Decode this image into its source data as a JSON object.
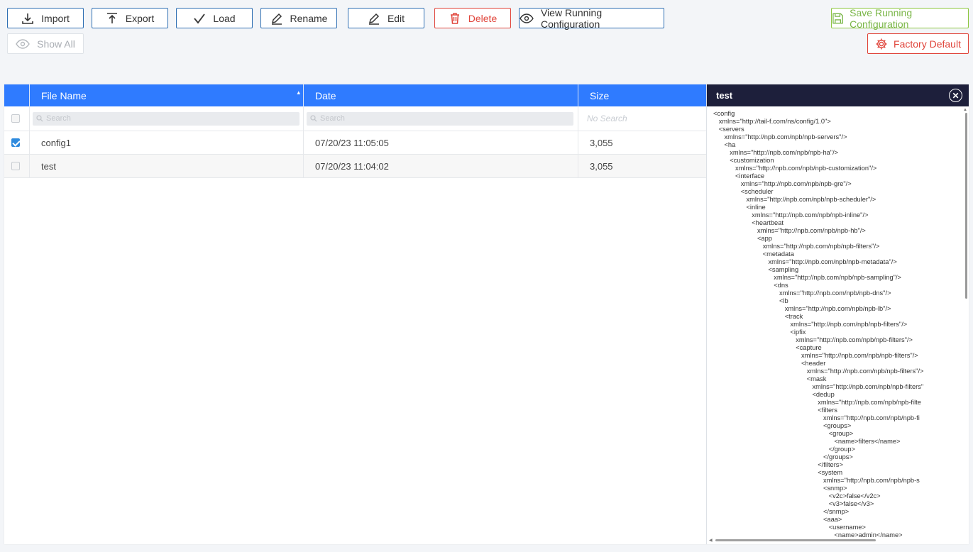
{
  "toolbar": {
    "import_label": "Import",
    "export_label": "Export",
    "load_label": "Load",
    "rename_label": "Rename",
    "edit_label": "Edit",
    "delete_label": "Delete",
    "view_running_label": "View Running Configuration",
    "show_all_label": "Show All",
    "save_running_label": "Save Running Configuration",
    "factory_default_label": "Factory Default"
  },
  "colors": {
    "accent": "#2f7bff",
    "button_border": "#2f6fb3",
    "danger": "#e0443a",
    "success": "#7ab648",
    "panel_header": "#1d1f3b"
  },
  "table": {
    "columns": [
      "File Name",
      "Date",
      "Size"
    ],
    "search_placeholder": "Search",
    "no_search_label": "No Search",
    "rows": [
      {
        "name": "config1",
        "date": "07/20/23 11:05:05",
        "size": "3,055",
        "checked": true
      },
      {
        "name": "test",
        "date": "07/20/23 11:04:02",
        "size": "3,055",
        "checked": false
      }
    ]
  },
  "preview": {
    "title": "test",
    "xml_lines": [
      "<config",
      "   xmlns=\"http://tail-f.com/ns/config/1.0\">",
      "   <servers",
      "      xmlns=\"http://npb.com/npb/npb-servers\"/>",
      "      <ha",
      "         xmlns=\"http://npb.com/npb/npb-ha\"/>",
      "         <customization",
      "            xmlns=\"http://npb.com/npb/npb-customization\"/>",
      "            <interface",
      "               xmlns=\"http://npb.com/npb/npb-gre\"/>",
      "               <scheduler",
      "                  xmlns=\"http://npb.com/npb/npb-scheduler\"/>",
      "                  <inline",
      "                     xmlns=\"http://npb.com/npb/npb-inline\"/>",
      "                     <heartbeat",
      "                        xmlns=\"http://npb.com/npb/npb-hb\"/>",
      "                        <app",
      "                           xmlns=\"http://npb.com/npb/npb-filters\"/>",
      "                           <metadata",
      "                              xmlns=\"http://npb.com/npb/npb-metadata\"/>",
      "                              <sampling",
      "                                 xmlns=\"http://npb.com/npb/npb-sampling\"/>",
      "                                 <dns",
      "                                    xmlns=\"http://npb.com/npb/npb-dns\"/>",
      "                                    <lb",
      "                                       xmlns=\"http://npb.com/npb/npb-lb\"/>",
      "                                       <track",
      "                                          xmlns=\"http://npb.com/npb/npb-filters\"/>",
      "                                          <ipfix",
      "                                             xmlns=\"http://npb.com/npb/npb-filters\"/>",
      "                                             <capture",
      "                                                xmlns=\"http://npb.com/npb/npb-filters\"/>",
      "                                                <header",
      "                                                   xmlns=\"http://npb.com/npb/npb-filters\"/>",
      "                                                   <mask",
      "                                                      xmlns=\"http://npb.com/npb/npb-filters\"",
      "                                                      <dedup",
      "                                                         xmlns=\"http://npb.com/npb/npb-filte",
      "                                                         <filters",
      "                                                            xmlns=\"http://npb.com/npb/npb-fi",
      "                                                            <groups>",
      "                                                               <group>",
      "                                                                  <name>filters</name>",
      "                                                               </group>",
      "                                                            </groups>",
      "                                                         </filters>",
      "                                                         <system",
      "                                                            xmlns=\"http://npb.com/npb/npb-s",
      "                                                            <snmp>",
      "                                                               <v2c>false</v2c>",
      "                                                               <v3>false</v3>",
      "                                                            </snmp>",
      "                                                            <aaa>",
      "                                                               <username>",
      "                                                                  <name>admin</name>"
    ]
  }
}
